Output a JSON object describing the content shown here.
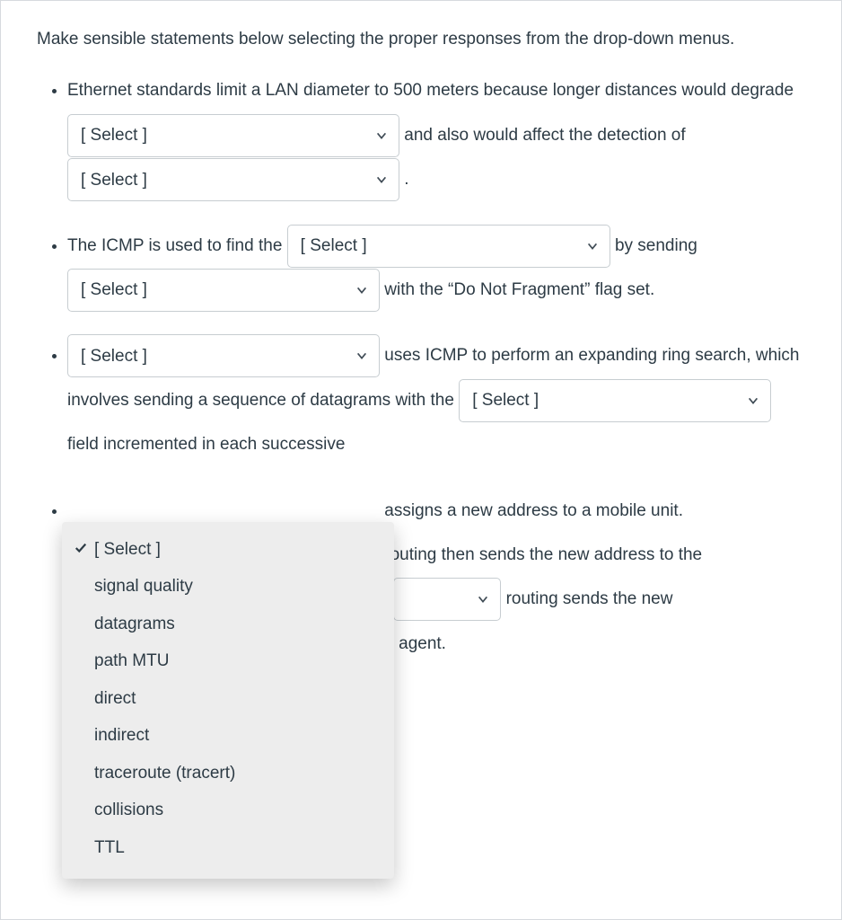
{
  "intro": "Make sensible statements below selecting the proper responses from the drop-down menus.",
  "select_placeholder": "[ Select ]",
  "bullets": {
    "b1": {
      "t1": "Ethernet standards limit a LAN diameter to 500 meters because longer distances would degrade ",
      "t2": " and also would affect the detection of ",
      "t3": "."
    },
    "b2": {
      "t1": "The ICMP is used to find the ",
      "t2": " by sending ",
      "t3": " with the “Do Not Fragment” flag set."
    },
    "b3": {
      "t1": " uses ICMP to perform an expanding ring search, which involves sending a sequence of datagrams with the ",
      "t2": " field incremented in each successive"
    },
    "b4": {
      "t1": " assigns a new address to a mobile unit. ",
      "t2": " routing then sends the new address to the ",
      "t3": " routing sends the new",
      "tail": "e agent."
    }
  },
  "dropdown": {
    "options": [
      "[ Select ]",
      "signal quality",
      "datagrams",
      "path MTU",
      "direct",
      "indirect",
      "traceroute (tracert)",
      "collisions",
      "TTL"
    ],
    "selected_index": 0
  }
}
